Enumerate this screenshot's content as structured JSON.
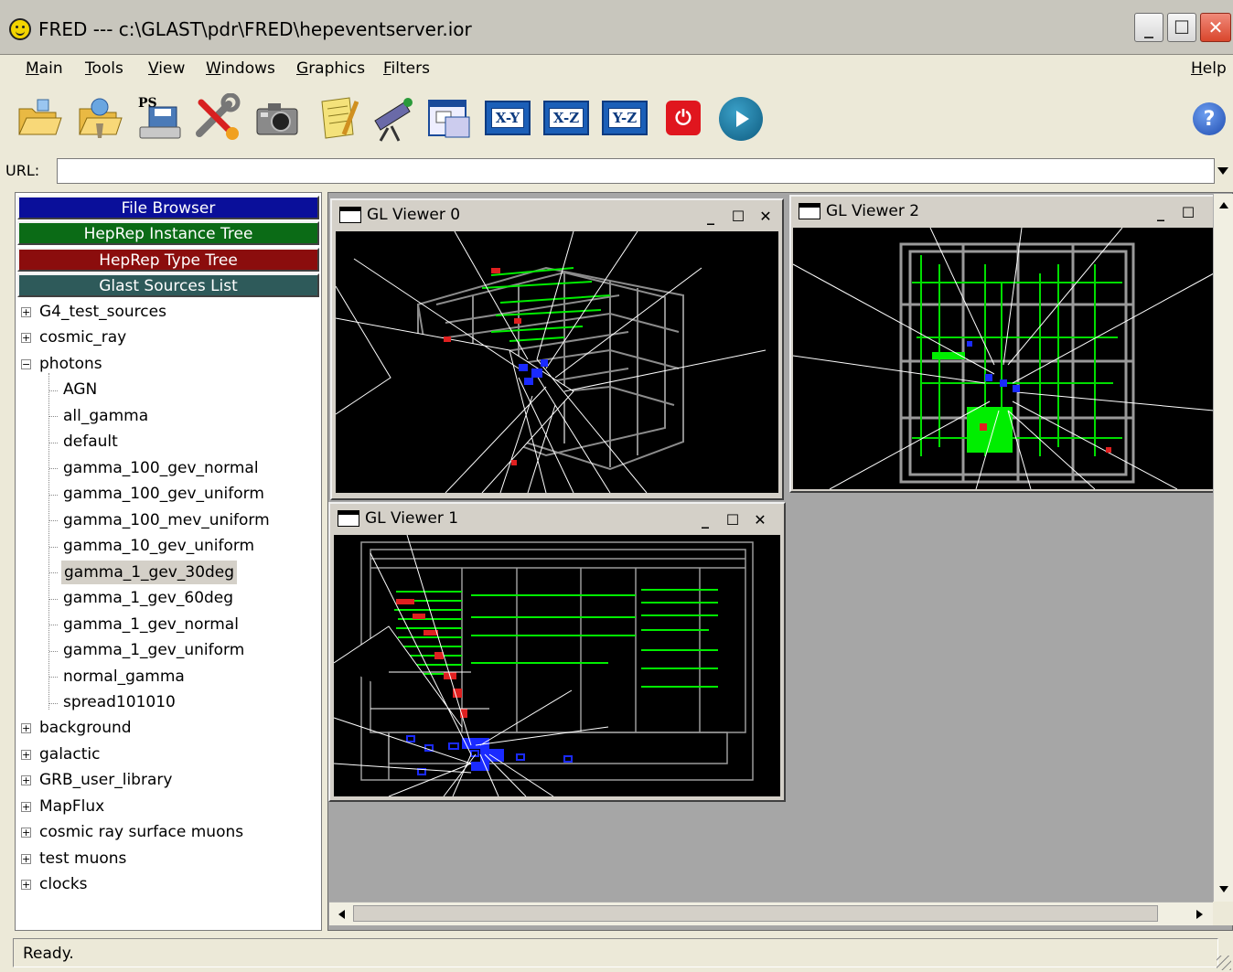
{
  "window": {
    "title": "FRED --- c:\\GLAST\\pdr\\FRED\\hepeventserver.ior"
  },
  "menu": {
    "items": [
      "Main",
      "Tools",
      "View",
      "Windows",
      "Graphics",
      "Filters"
    ],
    "help": "Help"
  },
  "toolbar": {
    "tools": [
      "open-folder-icon",
      "open-remote-icon",
      "save-ps-icon",
      "settings-tools-icon",
      "camera-icon",
      "notepad-icon",
      "telescope-icon",
      "window-layout-icon"
    ],
    "ps_label": "PS",
    "views": [
      "X-Y",
      "X-Z",
      "Y-Z"
    ],
    "stop_glyph": "⏻",
    "play_icon": "play-icon",
    "help_glyph": "?"
  },
  "url": {
    "label": "URL:",
    "value": ""
  },
  "panels": {
    "file_browser": "File Browser",
    "instance_tree": "HepRep Instance Tree",
    "type_tree": "HepRep Type Tree",
    "sources_list": "Glast Sources List"
  },
  "tree": {
    "top_before": [
      "G4_test_sources",
      "cosmic_ray"
    ],
    "expanded": "photons",
    "children": [
      "AGN",
      "all_gamma",
      "default",
      "gamma_100_gev_normal",
      "gamma_100_gev_uniform",
      "gamma_100_mev_uniform",
      "gamma_10_gev_uniform",
      "gamma_1_gev_30deg",
      "gamma_1_gev_60deg",
      "gamma_1_gev_normal",
      "gamma_1_gev_uniform",
      "normal_gamma",
      "spread101010"
    ],
    "selected": "gamma_1_gev_30deg",
    "top_after": [
      "background",
      "galactic",
      "GRB_user_library",
      "MapFlux",
      "cosmic ray surface muons",
      "test muons",
      "clocks"
    ]
  },
  "viewers": [
    {
      "label": "GL Viewer 0"
    },
    {
      "label": "GL Viewer 1"
    },
    {
      "label": "GL Viewer 2"
    }
  ],
  "status": {
    "text": "Ready."
  },
  "colors": {
    "file_browser": "#0a0f9a",
    "instance_tree": "#0b6b16",
    "type_tree": "#8b0d0d",
    "sources_list": "#2e5a5a"
  }
}
